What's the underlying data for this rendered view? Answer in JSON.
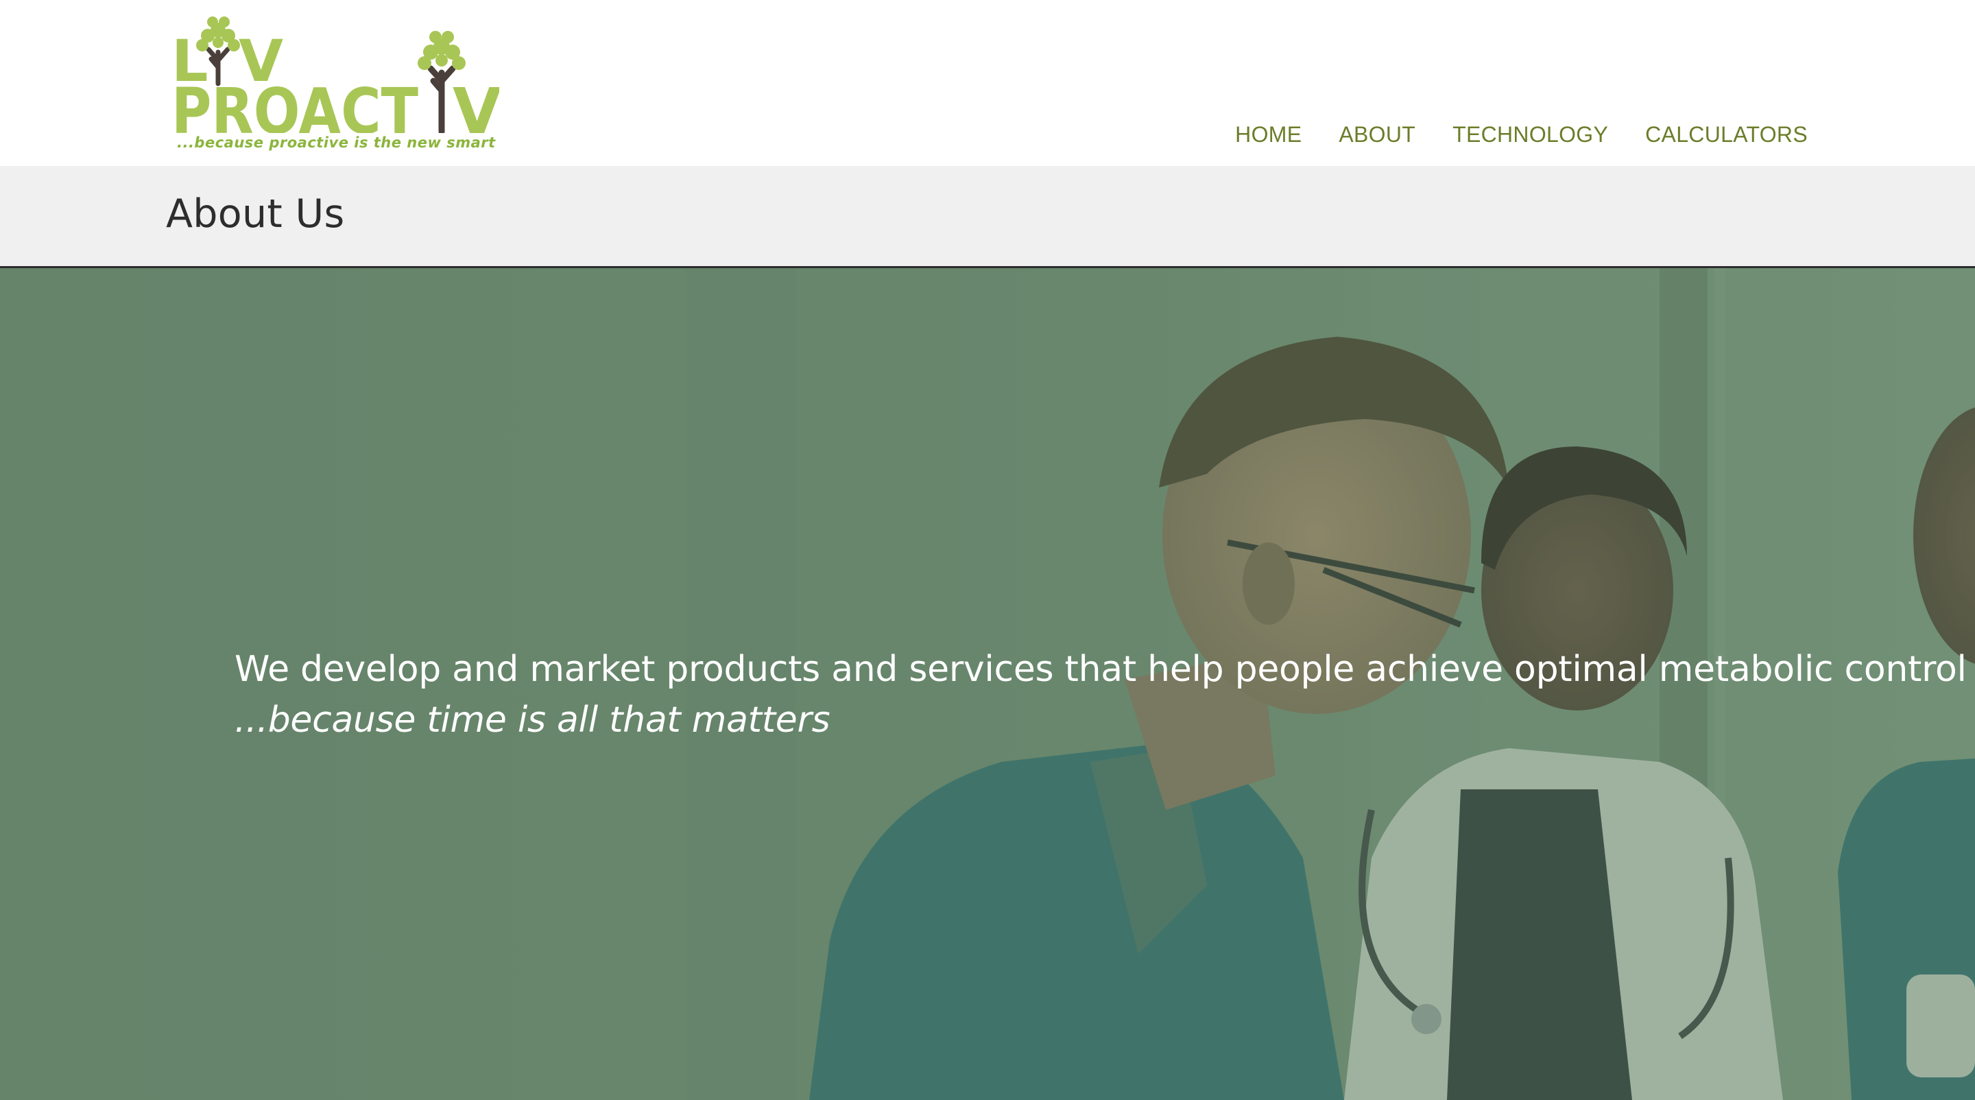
{
  "brand": {
    "logo_line1": "LIV",
    "logo_line2": "PROACTIV",
    "tagline": "...because proactive is the new smart",
    "logo_green": "#a8c655",
    "logo_trunk": "#4a3f3a"
  },
  "nav": {
    "items": [
      {
        "label": "HOME"
      },
      {
        "label": "ABOUT"
      },
      {
        "label": "TECHNOLOGY"
      },
      {
        "label": "CALCULATORS"
      }
    ],
    "color": "#6b7d2a"
  },
  "page_title": "About Us",
  "hero": {
    "headline": "We develop and market products and services that help people achieve optimal metabolic control",
    "tagline": "...because time is all that matters",
    "overlay_color": "#5c8062",
    "image": "medical-team-photo"
  }
}
